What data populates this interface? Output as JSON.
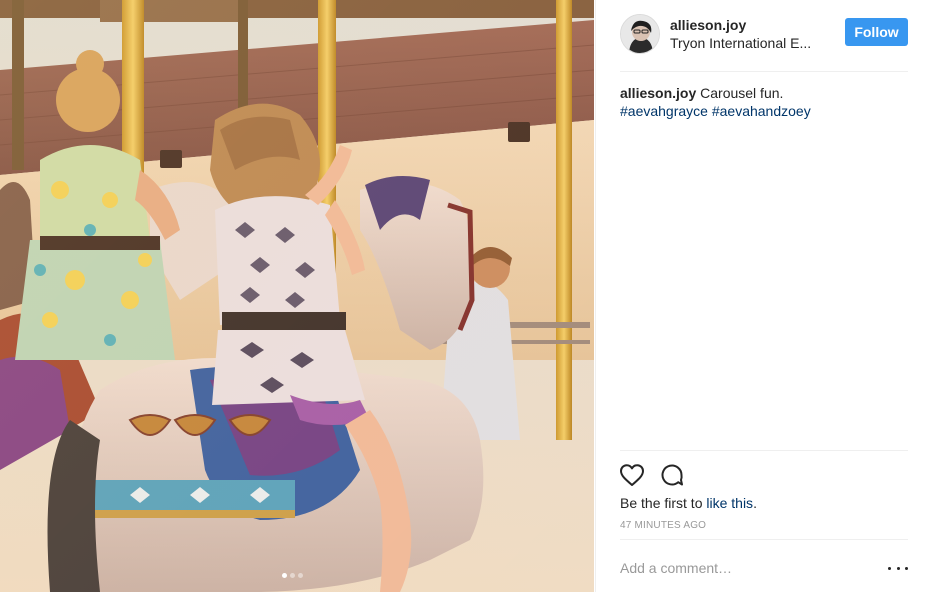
{
  "post": {
    "photo_alt": "Two girls riding carousel horses",
    "carousel": {
      "count": 3,
      "active_index": 0
    }
  },
  "header": {
    "username": "allieson.joy",
    "location": "Tryon International E...",
    "follow_label": "Follow"
  },
  "caption": {
    "username": "allieson.joy",
    "text": "Carousel fun.",
    "hashtags": [
      "#aevahgrayce",
      "#aevahandzoey"
    ]
  },
  "actions": {
    "like_icon": "heart-icon",
    "comment_icon": "comment-icon"
  },
  "likes": {
    "prefix": "Be the first to",
    "link": "like this",
    "suffix": "."
  },
  "timestamp": "47 minutes ago",
  "comment": {
    "placeholder": "Add a comment…",
    "more_icon": "more-options-icon"
  },
  "colors": {
    "follow_button": "#3897f0",
    "link": "#003569",
    "muted": "#999999",
    "divider": "#efefef"
  }
}
